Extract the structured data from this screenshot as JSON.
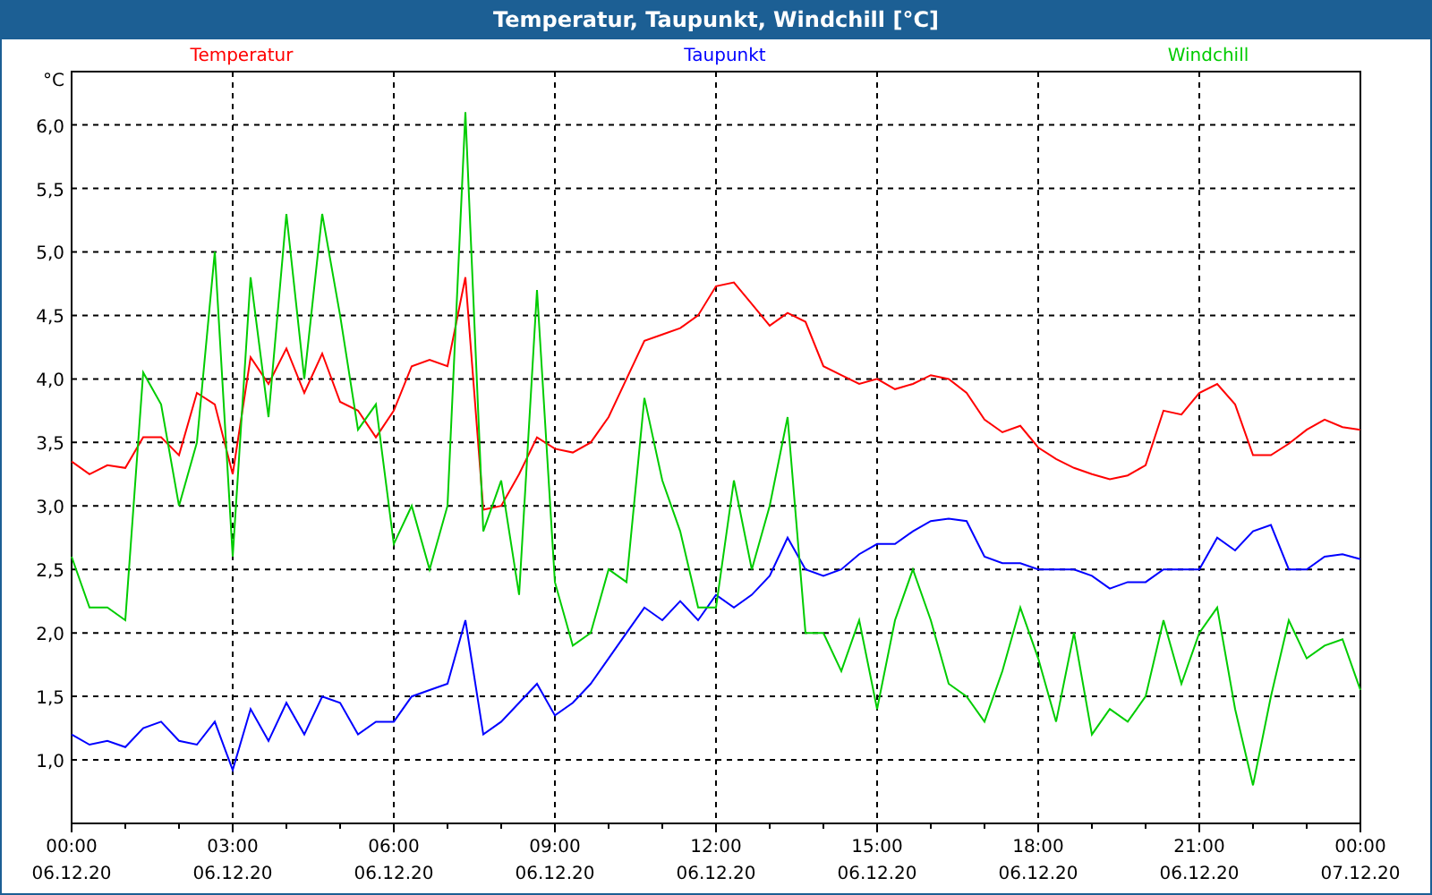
{
  "window": {
    "title": "Temperatur, Taupunkt, Windchill [°C]"
  },
  "chart": {
    "chart_data": {
      "type": "line",
      "ylabel": "°C",
      "categories": [
        "00:00\n06.12.20",
        null,
        null,
        null,
        null,
        null,
        null,
        null,
        null,
        "03:00\n06.12.20",
        null,
        null,
        null,
        null,
        null,
        null,
        null,
        null,
        "06:00\n06.12.20",
        null,
        null,
        null,
        null,
        null,
        null,
        null,
        null,
        "09:00\n06.12.20",
        null,
        null,
        null,
        null,
        null,
        null,
        null,
        null,
        "12:00\n06.12.20",
        null,
        null,
        null,
        null,
        null,
        null,
        null,
        null,
        "15:00\n06.12.20",
        null,
        null,
        null,
        null,
        null,
        null,
        null,
        null,
        "18:00\n06.12.20",
        null,
        null,
        null,
        null,
        null,
        null,
        null,
        null,
        "21:00\n06.12.20",
        null,
        null,
        null,
        null,
        null,
        null,
        null,
        null,
        "00:00\n07.12.20"
      ],
      "series": [
        {
          "name": "Temperatur",
          "color": "#ff0000",
          "values": [
            3.35,
            3.25,
            3.32,
            3.3,
            3.54,
            3.54,
            3.4,
            3.89,
            3.8,
            3.25,
            4.17,
            3.96,
            4.24,
            3.89,
            4.2,
            3.82,
            3.75,
            3.54,
            3.75,
            4.1,
            4.15,
            4.1,
            4.8,
            2.97,
            3.0,
            3.25,
            3.54,
            3.45,
            3.42,
            3.5,
            3.7,
            4.0,
            4.3,
            4.35,
            4.4,
            4.5,
            4.73,
            4.76,
            4.59,
            4.42,
            4.52,
            4.45,
            4.1,
            4.03,
            3.96,
            4.0,
            3.92,
            3.96,
            4.03,
            4.0,
            3.89,
            3.68,
            3.58,
            3.63,
            3.46,
            3.37,
            3.3,
            3.25,
            3.21,
            3.24,
            3.32,
            3.75,
            3.72,
            3.89,
            3.96,
            3.8,
            3.4,
            3.4,
            3.49,
            3.6,
            3.68,
            3.62,
            3.6
          ]
        },
        {
          "name": "Taupunkt",
          "color": "#0000ff",
          "values": [
            1.2,
            1.12,
            1.15,
            1.1,
            1.25,
            1.3,
            1.15,
            1.12,
            1.3,
            0.92,
            1.4,
            1.15,
            1.45,
            1.2,
            1.5,
            1.45,
            1.2,
            1.3,
            1.3,
            1.5,
            1.55,
            1.6,
            2.1,
            1.2,
            1.3,
            1.45,
            1.6,
            1.35,
            1.45,
            1.6,
            1.8,
            2.0,
            2.2,
            2.1,
            2.25,
            2.1,
            2.3,
            2.2,
            2.3,
            2.45,
            2.75,
            2.5,
            2.45,
            2.5,
            2.62,
            2.7,
            2.7,
            2.8,
            2.88,
            2.9,
            2.88,
            2.6,
            2.55,
            2.55,
            2.5,
            2.5,
            2.5,
            2.45,
            2.35,
            2.4,
            2.4,
            2.5,
            2.5,
            2.5,
            2.75,
            2.65,
            2.8,
            2.85,
            2.5,
            2.5,
            2.6,
            2.62,
            2.58
          ]
        },
        {
          "name": "Windchill",
          "color": "#00cc00",
          "values": [
            2.6,
            2.2,
            2.2,
            2.1,
            4.05,
            3.8,
            3.0,
            3.5,
            5.0,
            2.6,
            4.8,
            3.7,
            5.3,
            4.0,
            5.3,
            4.5,
            3.6,
            3.8,
            2.7,
            3.0,
            2.5,
            3.0,
            6.1,
            2.8,
            3.2,
            2.3,
            4.7,
            2.4,
            1.9,
            2.0,
            2.5,
            2.4,
            3.85,
            3.2,
            2.8,
            2.2,
            2.2,
            3.2,
            2.5,
            3.0,
            3.7,
            2.0,
            2.0,
            1.7,
            2.1,
            1.4,
            2.1,
            2.5,
            2.1,
            1.6,
            1.5,
            1.3,
            1.7,
            2.2,
            1.8,
            1.3,
            2.0,
            1.2,
            1.4,
            1.3,
            1.5,
            2.1,
            1.6,
            2.0,
            2.2,
            1.4,
            0.8,
            1.5,
            2.1,
            1.8,
            1.9,
            1.95,
            1.55
          ]
        }
      ],
      "ylim": [
        0.5,
        6.42
      ],
      "grid": true,
      "yticks": [
        {
          "value": 1,
          "label": "1,0"
        },
        {
          "value": 1.5,
          "label": "1,5"
        },
        {
          "value": 2,
          "label": "2,0"
        },
        {
          "value": 2.5,
          "label": "2,5"
        },
        {
          "value": 3,
          "label": "3,0"
        },
        {
          "value": 3.5,
          "label": "3,5"
        },
        {
          "value": 4,
          "label": "4,0"
        },
        {
          "value": 4.5,
          "label": "4,5"
        },
        {
          "value": 5,
          "label": "5,0"
        },
        {
          "value": 5.5,
          "label": "5,5"
        },
        {
          "value": 6,
          "label": "6,0"
        }
      ]
    }
  }
}
